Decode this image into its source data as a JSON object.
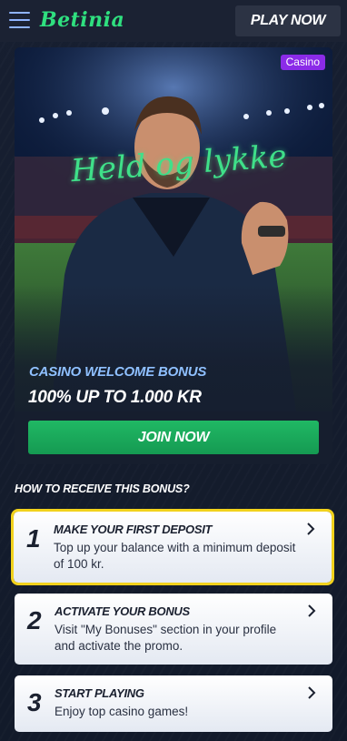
{
  "header": {
    "logo_text": "Betinia",
    "play_now_label": "PLAY NOW"
  },
  "hero": {
    "badge": "Casino",
    "script_text": "Held og lykke",
    "subtitle": "CASINO WELCOME BONUS",
    "title": "100% UP TO 1.000 KR",
    "join_label": "JOIN NOW"
  },
  "how": {
    "heading": "HOW TO RECEIVE THIS BONUS?",
    "steps": [
      {
        "number": "1",
        "title": "MAKE YOUR FIRST DEPOSIT",
        "desc": "Top up your balance with a minimum deposit of 100 kr."
      },
      {
        "number": "2",
        "title": "ACTIVATE YOUR BONUS",
        "desc": "Visit \"My Bonuses\" section in your profile and activate the promo."
      },
      {
        "number": "3",
        "title": "START PLAYING",
        "desc": "Enjoy top casino games!"
      }
    ]
  },
  "colors": {
    "accent_green": "#20b864",
    "badge_purple": "#8b2be8",
    "highlight_yellow": "#f2d21c",
    "subtitle_blue": "#8fc0ff"
  },
  "icons": [
    "menu-icon",
    "chevron-right-icon"
  ]
}
